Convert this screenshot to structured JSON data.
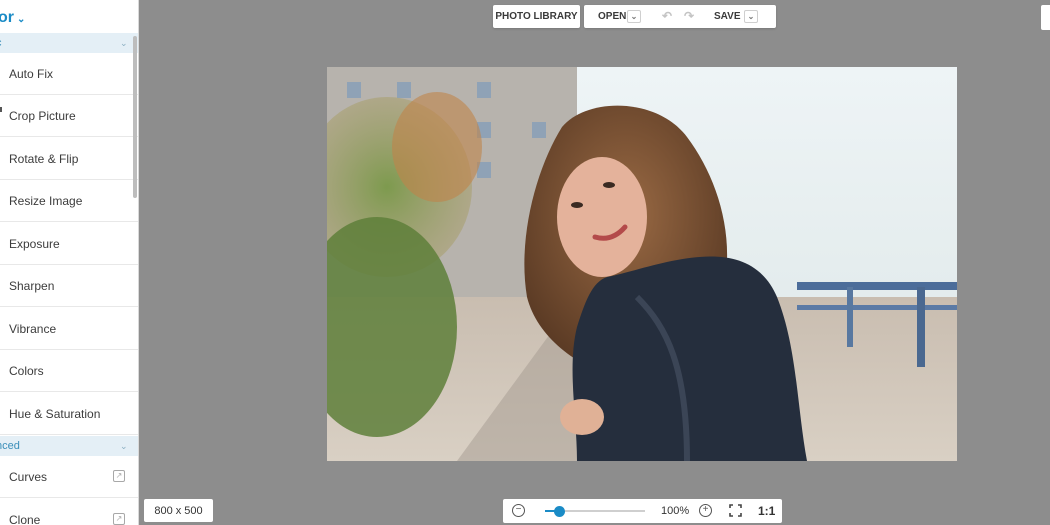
{
  "app": {
    "brand_fragment": "or",
    "brand_chevron": "⌄"
  },
  "sidebar": {
    "section_basic": {
      "label": "c",
      "chevron": "⌄"
    },
    "basic_tools": [
      {
        "label": "Auto Fix"
      },
      {
        "label": "Crop Picture"
      },
      {
        "label": "Rotate & Flip"
      },
      {
        "label": "Resize Image"
      },
      {
        "label": "Exposure"
      },
      {
        "label": "Sharpen"
      },
      {
        "label": "Vibrance"
      },
      {
        "label": "Colors"
      },
      {
        "label": "Hue & Saturation"
      }
    ],
    "section_advanced": {
      "label": "nced",
      "chevron": "⌄"
    },
    "advanced_tools": [
      {
        "label": "Curves",
        "icon": "edit-icon"
      },
      {
        "label": "Clone",
        "icon": "edit-icon"
      }
    ]
  },
  "toolbar": {
    "photo_library": "PHOTO LIBRARY",
    "open": "OPEN",
    "open_dropdown": "⌄",
    "undo": "↶",
    "redo": "↷",
    "save": "SAVE",
    "save_dropdown": "⌄"
  },
  "canvas": {
    "image_description": "photo of woman in leather jacket",
    "dimensions": "800 x 500"
  },
  "zoom": {
    "zoom_out": "−",
    "level": "100%",
    "slider_fraction": 0.14,
    "zoom_in": "+",
    "actual_size": "1:1"
  },
  "colors": {
    "accent": "#1a8bc6",
    "canvas_bg": "#8d8d8d",
    "section_bg": "#e4eff6"
  }
}
